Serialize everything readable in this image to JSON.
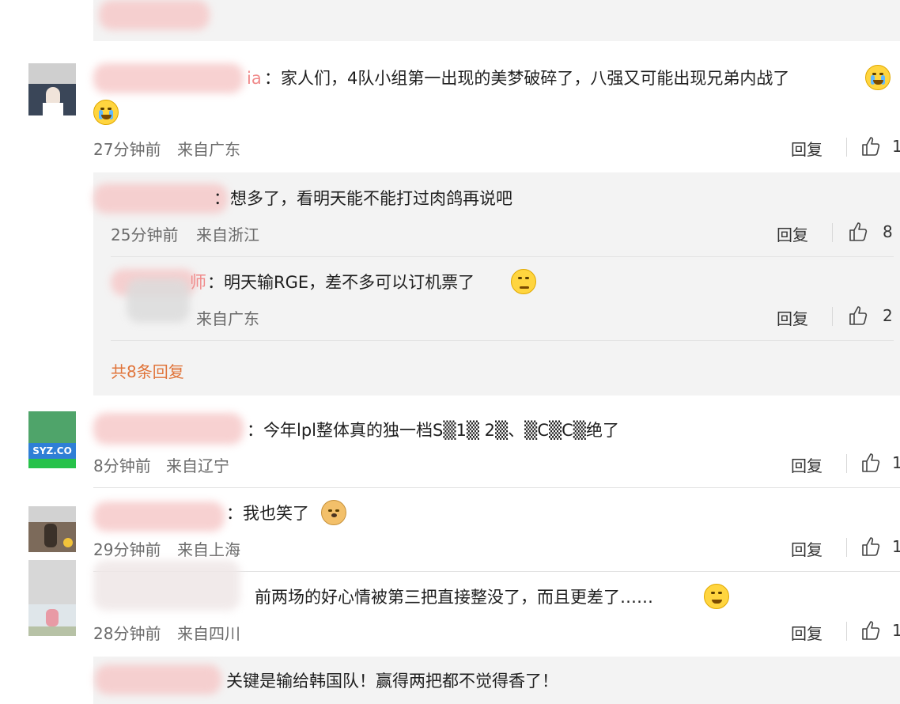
{
  "c1": {
    "name_suffix": "ia",
    "text": "：家人们，4队小组第一出现的美梦破碎了，八强又可能出现兄弟内战了",
    "time": "27分钟前",
    "loc": "来自广东",
    "likes": "1"
  },
  "r1": {
    "text": "：想多了，看明天能不能打过肉鸽再说吧",
    "time": "25分钟前",
    "loc": "来自浙江",
    "likes": "8"
  },
  "r2": {
    "name_suffix": "师",
    "text": "：明天输RGE，差不多可以订机票了",
    "loc": "来自广东",
    "likes": "2"
  },
  "replies_more": "共8条回复",
  "c2": {
    "text": "：今年lpl整体真的独一档S▒1▒ 2▒、▒C▒C▒绝了",
    "time": "8分钟前",
    "loc": "来自辽宁",
    "likes": "1"
  },
  "c3": {
    "text": "：我也笑了",
    "time": "29分钟前",
    "loc": "来自上海",
    "likes": "1"
  },
  "c4": {
    "text": "前两场的好心情被第三把直接整没了，而且更差了……",
    "time": "28分钟前",
    "loc": "来自四川",
    "likes": "1"
  },
  "c5": {
    "text": "关键是输给韩国队！赢得两把都不觉得香了！"
  },
  "reply_label": "回复",
  "avatar_c2_text": "SYZ.CO"
}
